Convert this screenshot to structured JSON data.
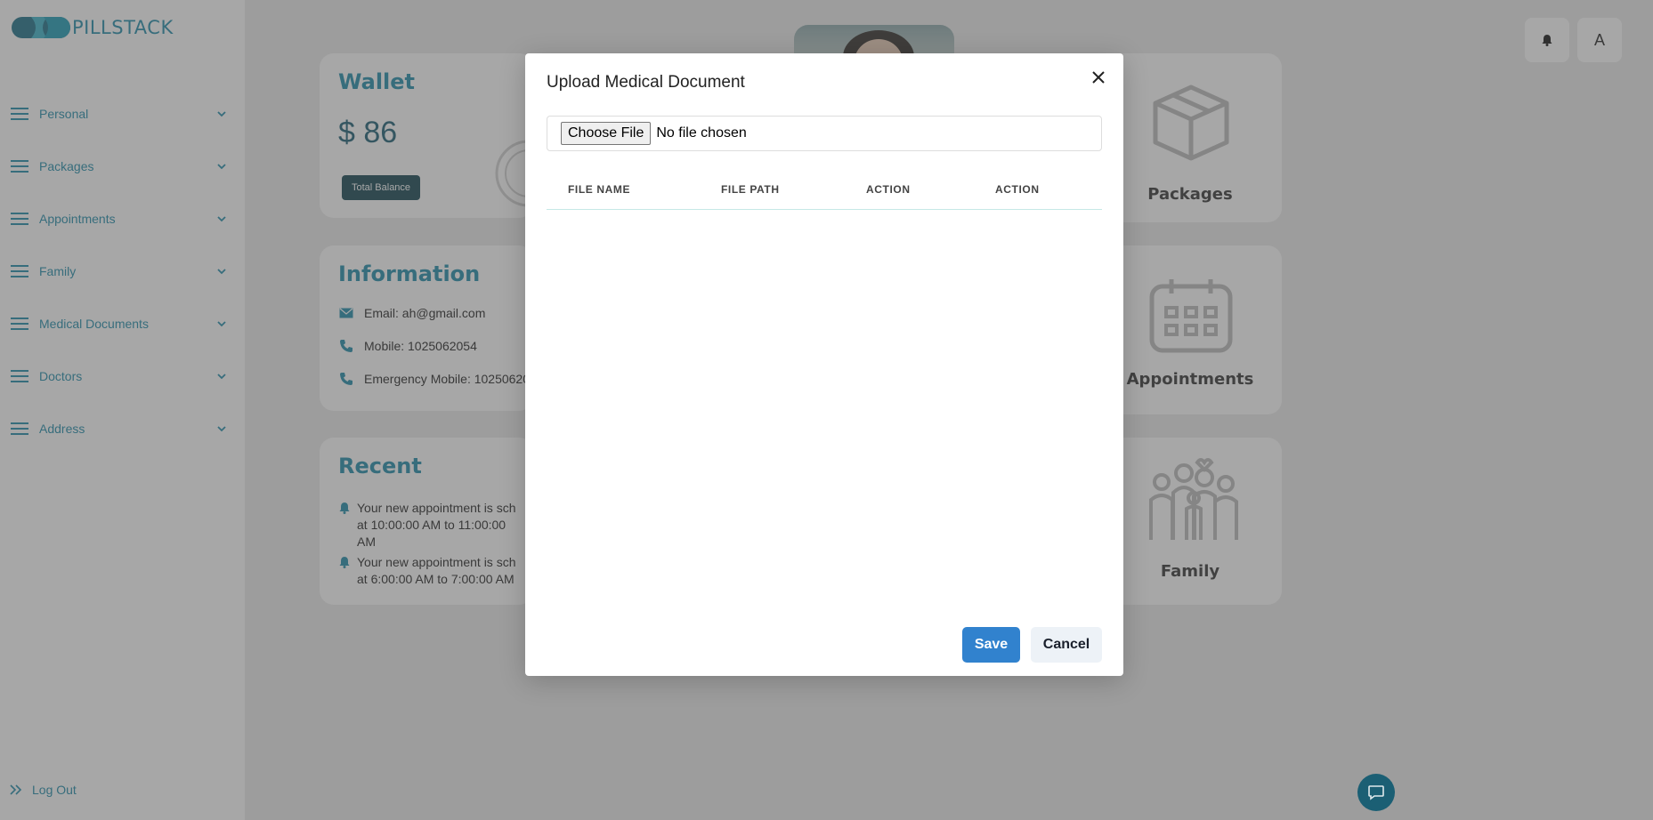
{
  "app": {
    "logo_text": "PILLSTACK"
  },
  "sidebar": {
    "items": [
      {
        "label": "Personal"
      },
      {
        "label": "Packages"
      },
      {
        "label": "Appointments"
      },
      {
        "label": "Family"
      },
      {
        "label": "Medical Documents"
      },
      {
        "label": "Doctors"
      },
      {
        "label": "Address"
      }
    ],
    "logout_label": "Log Out"
  },
  "header": {
    "avatar_initial": "A"
  },
  "wallet": {
    "title": "Wallet",
    "balance": "$ 86",
    "badge": "Total Balance"
  },
  "information": {
    "title": "Information",
    "email": "Email: ah@gmail.com",
    "mobile": "Mobile: 1025062054",
    "emergency": "Emergency Mobile: 10250620"
  },
  "recent": {
    "title": "Recent",
    "items": [
      {
        "line1": "Your new appointment is sch",
        "line2": "at 10:00:00 AM to 11:00:00 AM"
      },
      {
        "line1": "Your new appointment is sch",
        "line2": "at 6:00:00 AM to 7:00:00 AM"
      }
    ]
  },
  "tiles": {
    "packages": "Packages",
    "appointments": "Appointments",
    "family": "Family"
  },
  "modal": {
    "title": "Upload Medical Document",
    "choose_file_label": "Choose File",
    "no_file_text": "No file chosen",
    "columns": [
      "FILE NAME",
      "FILE PATH",
      "ACTION",
      "ACTION"
    ],
    "save_label": "Save",
    "cancel_label": "Cancel"
  },
  "colors": {
    "brand": "#1f8aa8",
    "dark_teal": "#13434f",
    "primary_button": "#3182ce"
  }
}
